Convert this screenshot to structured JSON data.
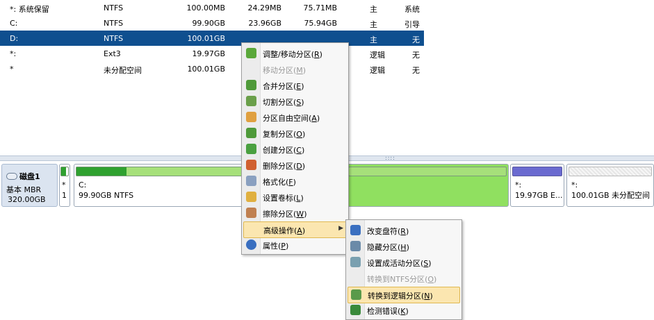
{
  "partitions": [
    {
      "name": "*: 系统保留",
      "fs": "NTFS",
      "capacity": "100.00MB",
      "used": "24.29MB",
      "free": "75.71MB",
      "type": "主",
      "status": "系统"
    },
    {
      "name": "C:",
      "fs": "NTFS",
      "capacity": "99.90GB",
      "used": "23.96GB",
      "free": "75.94GB",
      "type": "主",
      "status": "引导"
    },
    {
      "name": "D:",
      "fs": "NTFS",
      "capacity": "100.01GB",
      "used": "",
      "free": "",
      "type": "主",
      "status": "无"
    },
    {
      "name": "*:",
      "fs": "Ext3",
      "capacity": "19.97GB",
      "used": "",
      "free": "",
      "type": "逻辑",
      "status": "无"
    },
    {
      "name": "*",
      "fs": "未分配空间",
      "capacity": "100.01GB",
      "used": "",
      "free": "",
      "type": "逻辑",
      "status": "无"
    }
  ],
  "disk": {
    "name": "磁盘1",
    "type": "基本 MBR",
    "size": "320.00GB"
  },
  "diskmap": [
    {
      "label1": "*",
      "label2": "1",
      "used_fraction": 0.3
    },
    {
      "label1": "C:",
      "label2": "99.90GB NTFS",
      "used_fraction": 0.24
    },
    {
      "label1": "",
      "label2": "",
      "used_fraction": 1.0
    },
    {
      "label1": "*:",
      "label2": "19.97GB E...",
      "used_fraction": 1.0
    },
    {
      "label1": "*:",
      "label2": "100.01GB 未分配空间",
      "used_fraction": 0
    }
  ],
  "menu": [
    {
      "text": "调整/移动分区",
      "key": "R",
      "icon": "resize-move-icon"
    },
    {
      "text": "移动分区",
      "key": "M",
      "icon": "",
      "disabled": true
    },
    {
      "text": "合并分区",
      "key": "E",
      "icon": "merge-icon"
    },
    {
      "text": "切割分区",
      "key": "S",
      "icon": "split-icon"
    },
    {
      "text": "分区自由空间",
      "key": "A",
      "icon": "allocate-space-icon"
    },
    {
      "text": "复制分区",
      "key": "O",
      "icon": "copy-icon"
    },
    {
      "text": "创建分区",
      "key": "C",
      "icon": "create-icon"
    },
    {
      "text": "删除分区",
      "key": "D",
      "icon": "delete-icon"
    },
    {
      "text": "格式化",
      "key": "F",
      "icon": "format-icon"
    },
    {
      "text": "设置卷标",
      "key": "L",
      "icon": "label-icon"
    },
    {
      "text": "擦除分区",
      "key": "W",
      "icon": "wipe-icon"
    },
    {
      "text": "高级操作",
      "key": "A",
      "icon": "",
      "submenu": true,
      "highlighted": true
    },
    {
      "text": "属性",
      "key": "P",
      "icon": "info-icon"
    }
  ],
  "submenu": [
    {
      "text": "改变盘符",
      "key": "R",
      "icon": "change-letter-icon"
    },
    {
      "text": "隐藏分区",
      "key": "H",
      "icon": "hide-icon"
    },
    {
      "text": "设置成活动分区",
      "key": "S",
      "icon": "set-active-icon"
    },
    {
      "text": "转换到NTFS分区",
      "key": "O",
      "icon": "",
      "disabled": true
    },
    {
      "text": "转换到逻辑分区",
      "key": "N",
      "icon": "convert-logical-icon",
      "highlighted": true
    },
    {
      "text": "检测错误",
      "key": "K",
      "icon": "check-errors-icon"
    }
  ],
  "colors": {
    "selection": "#0f4f8f",
    "menu_highlight": "#fbe6b0",
    "used_green": "#2fa12f",
    "free_green": "#a6e07a",
    "ext_blue": "#6a6ad0"
  }
}
